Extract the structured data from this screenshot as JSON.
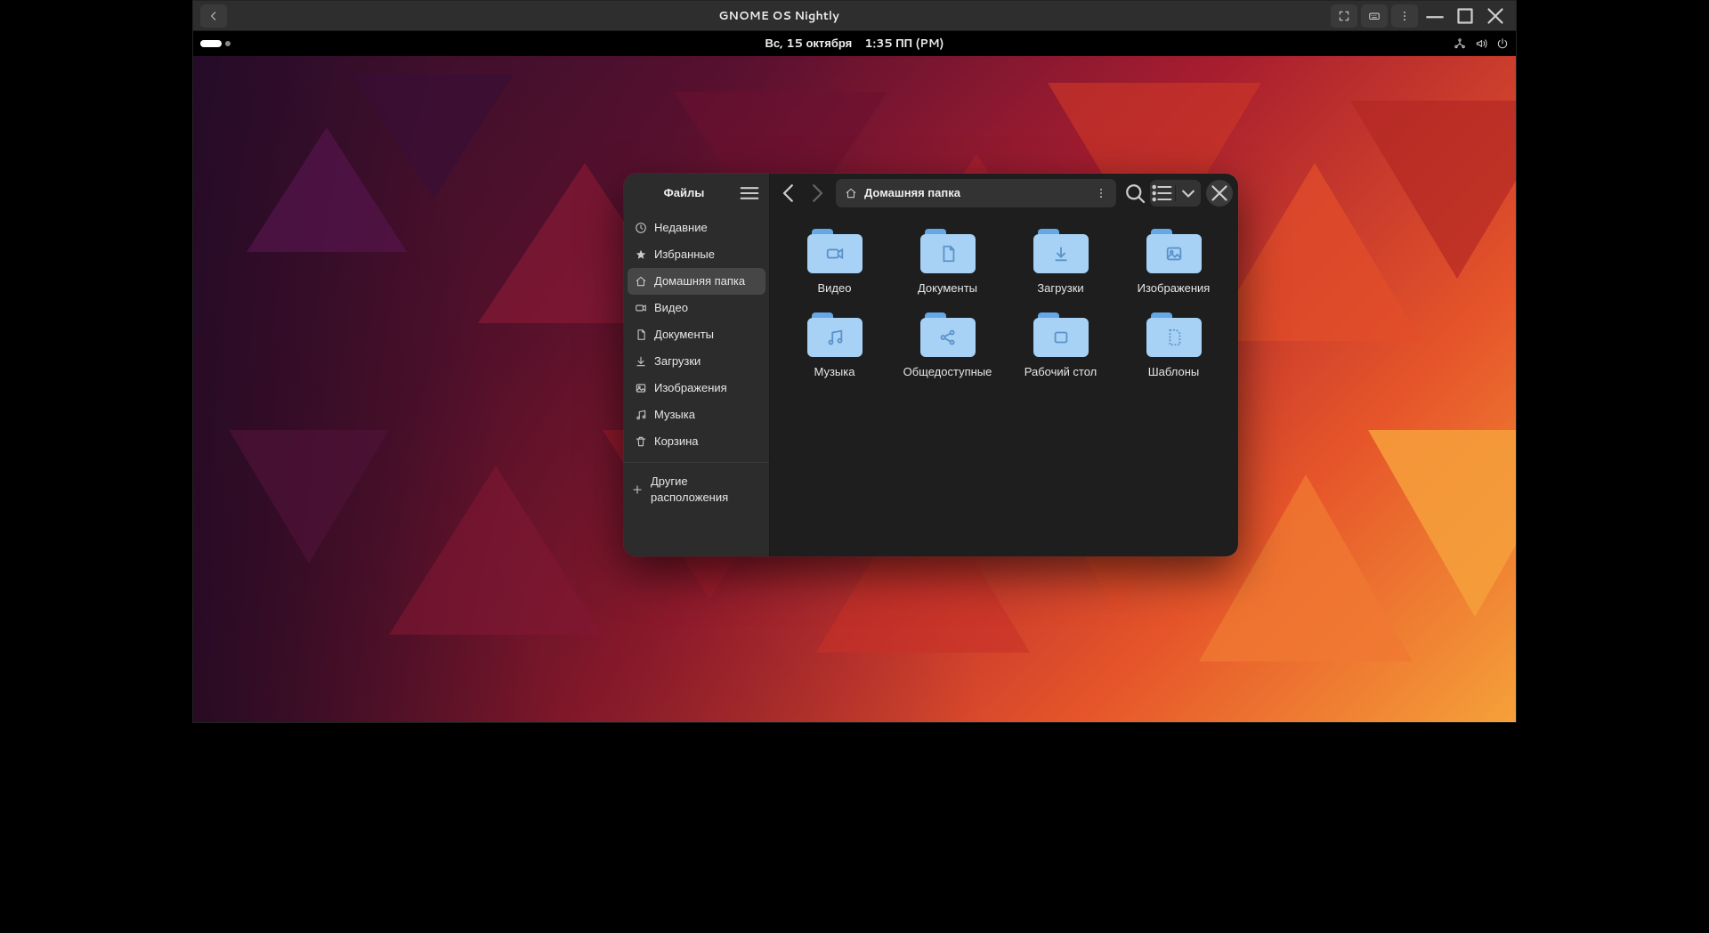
{
  "boxes": {
    "title": "GNOME OS Nightly"
  },
  "gnome_bar": {
    "date": "Вс, 15 октября",
    "time": "1:35 ПП (PM)"
  },
  "nautilus": {
    "sidebar_title": "Файлы",
    "pathbar_label": "Домашняя папка",
    "sidebar": [
      {
        "icon": "clock",
        "label": "Недавние"
      },
      {
        "icon": "star",
        "label": "Избранные"
      },
      {
        "icon": "home",
        "label": "Домашняя папка",
        "active": true
      },
      {
        "icon": "video",
        "label": "Видео"
      },
      {
        "icon": "doc",
        "label": "Документы"
      },
      {
        "icon": "download",
        "label": "Загрузки"
      },
      {
        "icon": "image",
        "label": "Изображения"
      },
      {
        "icon": "music",
        "label": "Музыка"
      },
      {
        "icon": "trash",
        "label": "Корзина"
      }
    ],
    "other_locations": "Другие расположения",
    "folders": [
      {
        "icon": "video",
        "label": "Видео"
      },
      {
        "icon": "doc",
        "label": "Документы"
      },
      {
        "icon": "download",
        "label": "Загрузки"
      },
      {
        "icon": "image",
        "label": "Изображения"
      },
      {
        "icon": "music",
        "label": "Музыка"
      },
      {
        "icon": "share",
        "label": "Общедоступные"
      },
      {
        "icon": "desk",
        "label": "Рабочий стол"
      },
      {
        "icon": "template",
        "label": "Шаблоны"
      }
    ]
  }
}
